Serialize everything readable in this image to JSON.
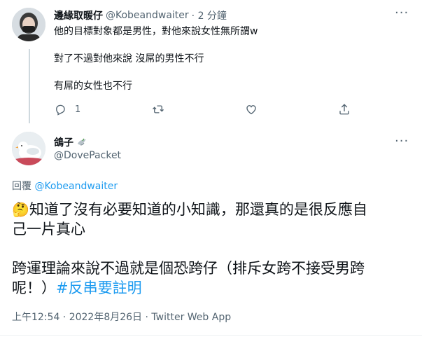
{
  "reply_tweet": {
    "display_name": "邊緣取暖仔",
    "handle": "@Kobeandwaiter",
    "time": "· 2 分鐘",
    "lines": [
      "他的目標對象都是男性，對他來說女性無所謂w",
      "對了不過對他來說 沒屌的男性不行",
      "有屌的女性也不行"
    ],
    "reply_count": "1",
    "icons": [
      "reply-icon",
      "retweet-icon",
      "like-icon",
      "share-icon",
      "more-icon"
    ]
  },
  "main_tweet": {
    "display_name": "鴿子",
    "handle": "@DovePacket",
    "replying_prefix": "回覆",
    "replying_to": "@Kobeandwaiter",
    "emoji": "🤔",
    "text_line1": "知道了沒有必要知道的小知識，那還真的是很反應自",
    "text_line2": "己一片真心",
    "text_line3": "跨運理論來說不過就是個恐跨仔（排斥女跨不接受男跨",
    "text_line4_plain": "呢！）",
    "hashtag": "#反串要註明",
    "timestamp": "上午12:54 · 2022年8月26日 · Twitter Web App"
  },
  "colors": {
    "accent": "#1d9bf0",
    "secondary_text": "#536471",
    "primary_text": "#0f1419",
    "divider": "#eff3f4"
  }
}
